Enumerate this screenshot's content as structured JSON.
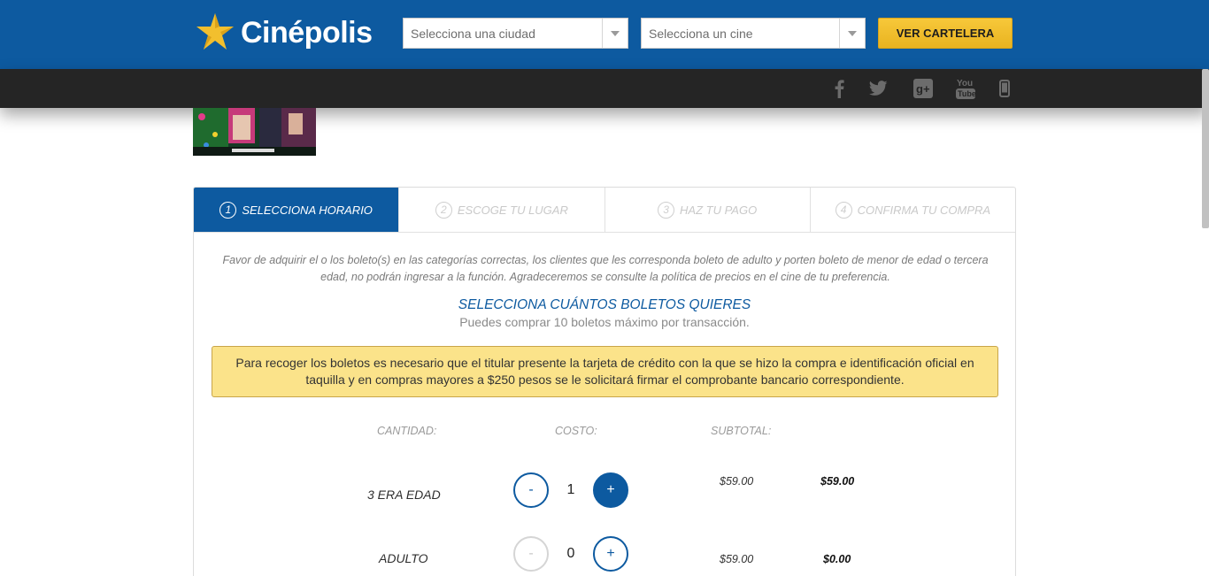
{
  "header": {
    "logo_text": "Cinépolis",
    "city_placeholder": "Selecciona una ciudad",
    "cine_placeholder": "Selecciona un cine",
    "cartelera_label": "VER CARTELERA",
    "brand_color": "#0d5aa0",
    "accent_color": "#f2bf2e"
  },
  "social": [
    "facebook-icon",
    "twitter-icon",
    "google-plus-icon",
    "youtube-icon",
    "mobile-icon"
  ],
  "steps": [
    {
      "num": "1",
      "label": "SELECCIONA HORARIO",
      "active": true
    },
    {
      "num": "2",
      "label": "ESCOGE TU LUGAR",
      "active": false
    },
    {
      "num": "3",
      "label": "HAZ TU PAGO",
      "active": false
    },
    {
      "num": "4",
      "label": "CONFIRMA TU COMPRA",
      "active": false
    }
  ],
  "notice": "Favor de adquirir el o los boleto(s) en las categorías correctas, los clientes que les corresponda boleto de adulto y porten boleto de menor de edad o tercera edad, no podrán ingresar a la función. Agradeceremos se consulte la política de precios en el cine de tu preferencia.",
  "tickets": {
    "title": "SELECCIONA CUÁNTOS BOLETOS QUIERES",
    "subtitle": "Puedes comprar 10 boletos máximo por transacción.",
    "alert": "Para recoger los boletos es necesario que el titular presente la tarjeta de crédito con la que se hizo la compra e identificación oficial en taquilla y en compras mayores a $250 pesos se le solicitará firmar el comprobante bancario correspondiente.",
    "col_cantidad": "CANTIDAD:",
    "col_costo": "COSTO:",
    "col_subtotal": "SUBTOTAL:",
    "rows": [
      {
        "label": "3 ERA EDAD",
        "minus": "-",
        "qty": "1",
        "plus": "+",
        "price": "$59.00",
        "subtotal": "$59.00"
      },
      {
        "label": "ADULTO",
        "minus": "-",
        "qty": "0",
        "plus": "+",
        "price": "$59.00",
        "subtotal": "$0.00"
      }
    ]
  }
}
